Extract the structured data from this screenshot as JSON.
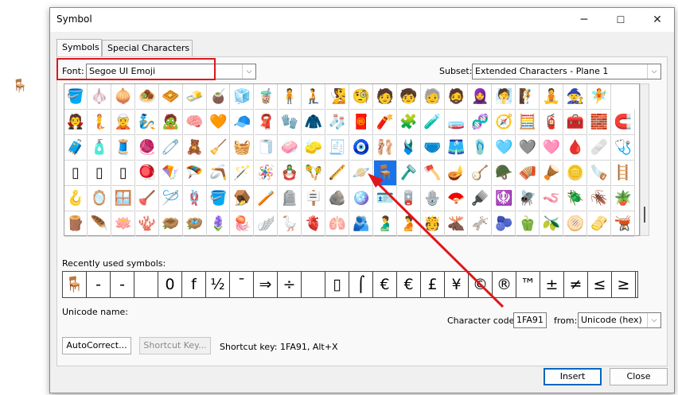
{
  "background": {
    "doc_glyph": "🪑",
    "accent_color": "#1a73e8",
    "annotation_color": "#e0161b"
  },
  "dialog": {
    "title": "Symbol",
    "controls": {
      "minimize": "─",
      "maximize": "☐",
      "close": "✕"
    },
    "tabs": [
      {
        "label": "Symbols",
        "active": true
      },
      {
        "label": "Special Characters",
        "active": false
      }
    ],
    "font": {
      "label": "Font:",
      "value": "Segoe UI Emoji"
    },
    "subset": {
      "label": "Subset:",
      "value": "Extended Characters - Plane 1"
    },
    "grid": {
      "selected_glyph": "🪑",
      "rows": [
        [
          "🪣",
          "🧄",
          "🧅",
          "🧆",
          "🧇",
          "🧈",
          "🧉",
          "🧊",
          "🧋",
          "🧍",
          "🧎",
          "🧏",
          "🧐",
          "🧑",
          "🧒",
          "🧓",
          "🧔",
          "🧕",
          "🧖",
          "🧗",
          "🧘",
          "🧙",
          "🧚"
        ],
        [
          "🧛",
          "🧜",
          "🧝",
          "🧞",
          "🧟",
          "🧠",
          "🧡",
          "🧢",
          "🧣",
          "🧤",
          "🧥",
          "🧦",
          "🧧",
          "🧨",
          "🧩",
          "🧪",
          "🧫",
          "🧬",
          "🧭",
          "🧮",
          "🧯",
          "🧰",
          "🧱",
          "🧲"
        ],
        [
          "🧳",
          "🧴",
          "🧵",
          "🧶",
          "🧷",
          "🧸",
          "🧹",
          "🧺",
          "🧻",
          "🧼",
          "🧽",
          "🧾",
          "🧿",
          "🩰",
          "🩱",
          "🩲",
          "🩳",
          "🩴",
          "🩵",
          "🩶",
          "🩷",
          "🩸",
          "🩹",
          "🩺"
        ],
        [
          "▯",
          "▯",
          "▯",
          "🪀",
          "🪁",
          "🪂",
          "🪃",
          "🪄",
          "🪅",
          "🪆",
          "🪇",
          "🪈",
          "🪐",
          "🪑",
          "🪒",
          "🪓",
          "🪔",
          "🪕",
          "🪖",
          "🪗",
          "🪘",
          "🪙",
          "🪚",
          "🪜"
        ],
        [
          "🪝",
          "🪞",
          "🪟",
          "🪠",
          "🪡",
          "🪢",
          "🪣",
          "🪤",
          "🪥",
          "🪦",
          "🪧",
          "🪨",
          "🪩",
          "🪪",
          "🪫",
          "🪬",
          "🪭",
          "🪮",
          "🪯",
          "🪰",
          "🪱",
          "🪲",
          "🪳",
          "🪴"
        ],
        [
          "🪵",
          "🪶",
          "🪷",
          "🪸",
          "🪹",
          "🪺",
          "🪻",
          "🪼",
          "🪽",
          "🪿",
          "🫀",
          "🫁",
          "🫂",
          "🫃",
          "🫄",
          "🫅",
          "🫎",
          "🫏",
          "🫐",
          "🫑",
          "🫒",
          "🫓",
          "🫔",
          "🫕"
        ]
      ]
    },
    "recent": {
      "label": "Recently used symbols:",
      "glyphs": [
        "🪑",
        "-",
        "-",
        "",
        "0",
        "f",
        "½",
        "¯",
        "⇒",
        "÷",
        "",
        "▯",
        "⌠",
        "€",
        "€",
        "£",
        "¥",
        "©",
        "®",
        "™",
        "±",
        "≠",
        "≤",
        "≥"
      ]
    },
    "unicode_name": {
      "label": "Unicode name:",
      "value": ""
    },
    "char_code": {
      "label": "Character code:",
      "value": "1FA91"
    },
    "from": {
      "label": "from:",
      "value": "Unicode (hex)"
    },
    "buttons": {
      "autocorrect": "AutoCorrect...",
      "shortcut_key": "Shortcut Key...",
      "insert": "Insert",
      "close": "Close"
    },
    "shortcut_text": "Shortcut key: 1FA91, Alt+X"
  }
}
